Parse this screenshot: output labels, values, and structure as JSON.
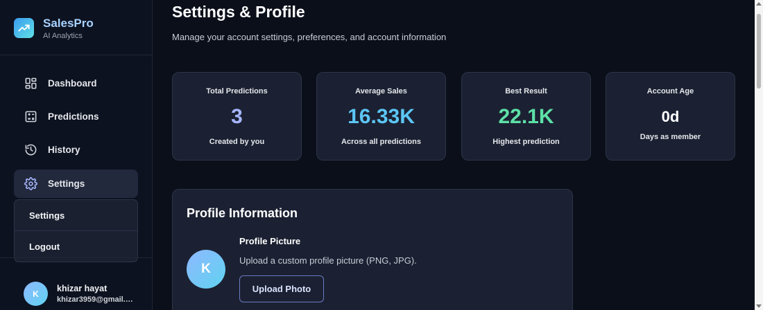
{
  "brand": {
    "name": "SalesPro",
    "subtitle": "AI Analytics",
    "icon": "trending-up-icon"
  },
  "sidebar": {
    "items": [
      {
        "label": "Dashboard",
        "icon": "dashboard-icon",
        "active": false
      },
      {
        "label": "Predictions",
        "icon": "calculator-icon",
        "active": false
      },
      {
        "label": "History",
        "icon": "history-icon",
        "active": false
      },
      {
        "label": "Settings",
        "icon": "gear-icon",
        "active": true
      }
    ],
    "dropdown": [
      {
        "label": "Settings"
      },
      {
        "label": "Logout"
      }
    ]
  },
  "user": {
    "initial": "K",
    "name": "khizar hayat",
    "email": "khizar3959@gmail.com"
  },
  "page": {
    "title": "Settings & Profile",
    "subtitle": "Manage your account settings, preferences, and account information"
  },
  "stats": [
    {
      "label": "Total Predictions",
      "value": "3",
      "caption": "Created by you",
      "color": "#a7b6ff"
    },
    {
      "label": "Average Sales",
      "value": "16.33K",
      "caption": "Across all predictions",
      "color": "#5cc6f5"
    },
    {
      "label": "Best Result",
      "value": "22.1K",
      "caption": "Highest prediction",
      "color": "#5ee0a8"
    },
    {
      "label": "Account Age",
      "value": "0d",
      "caption": "Days as member",
      "color": "#ffffff"
    }
  ],
  "profile": {
    "title": "Profile Information",
    "avatar_initial": "K",
    "picture_label": "Profile Picture",
    "picture_desc": "Upload a custom profile picture (PNG, JPG).",
    "upload_label": "Upload Photo"
  },
  "colors": {
    "background": "#0b0f1a",
    "card": "#1b2132",
    "accent": "#5cc6f5"
  }
}
